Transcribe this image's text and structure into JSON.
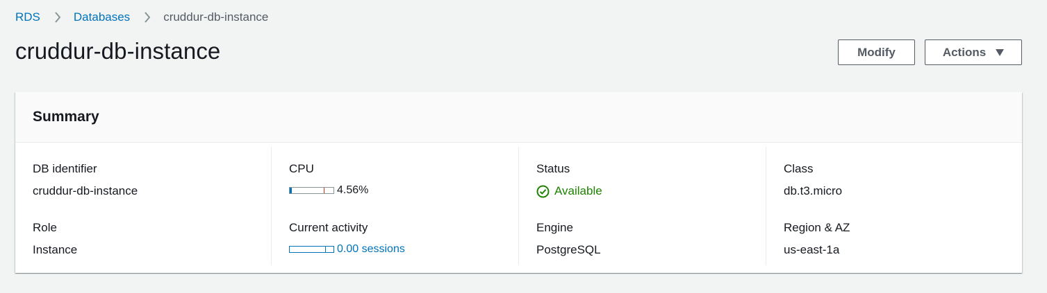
{
  "breadcrumb": {
    "items": [
      "RDS",
      "Databases"
    ],
    "current": "cruddur-db-instance"
  },
  "page": {
    "title": "cruddur-db-instance"
  },
  "actions": {
    "modify_label": "Modify",
    "actions_label": "Actions"
  },
  "summary": {
    "title": "Summary",
    "db_identifier": {
      "label": "DB identifier",
      "value": "cruddur-db-instance"
    },
    "role": {
      "label": "Role",
      "value": "Instance"
    },
    "cpu": {
      "label": "CPU",
      "value": "4.56%",
      "fraction": 0.0456
    },
    "current_activity": {
      "label": "Current activity",
      "value": "0.00 sessions",
      "fraction": 0.0
    },
    "status": {
      "label": "Status",
      "value": "Available",
      "icon": "check-circle-icon",
      "color": "#1d8102"
    },
    "engine": {
      "label": "Engine",
      "value": "PostgreSQL"
    },
    "class": {
      "label": "Class",
      "value": "db.t3.micro"
    },
    "region_az": {
      "label": "Region & AZ",
      "value": "us-east-1a"
    }
  },
  "colors": {
    "link": "#0073bb",
    "background": "#f2f3f3",
    "success": "#1d8102"
  }
}
